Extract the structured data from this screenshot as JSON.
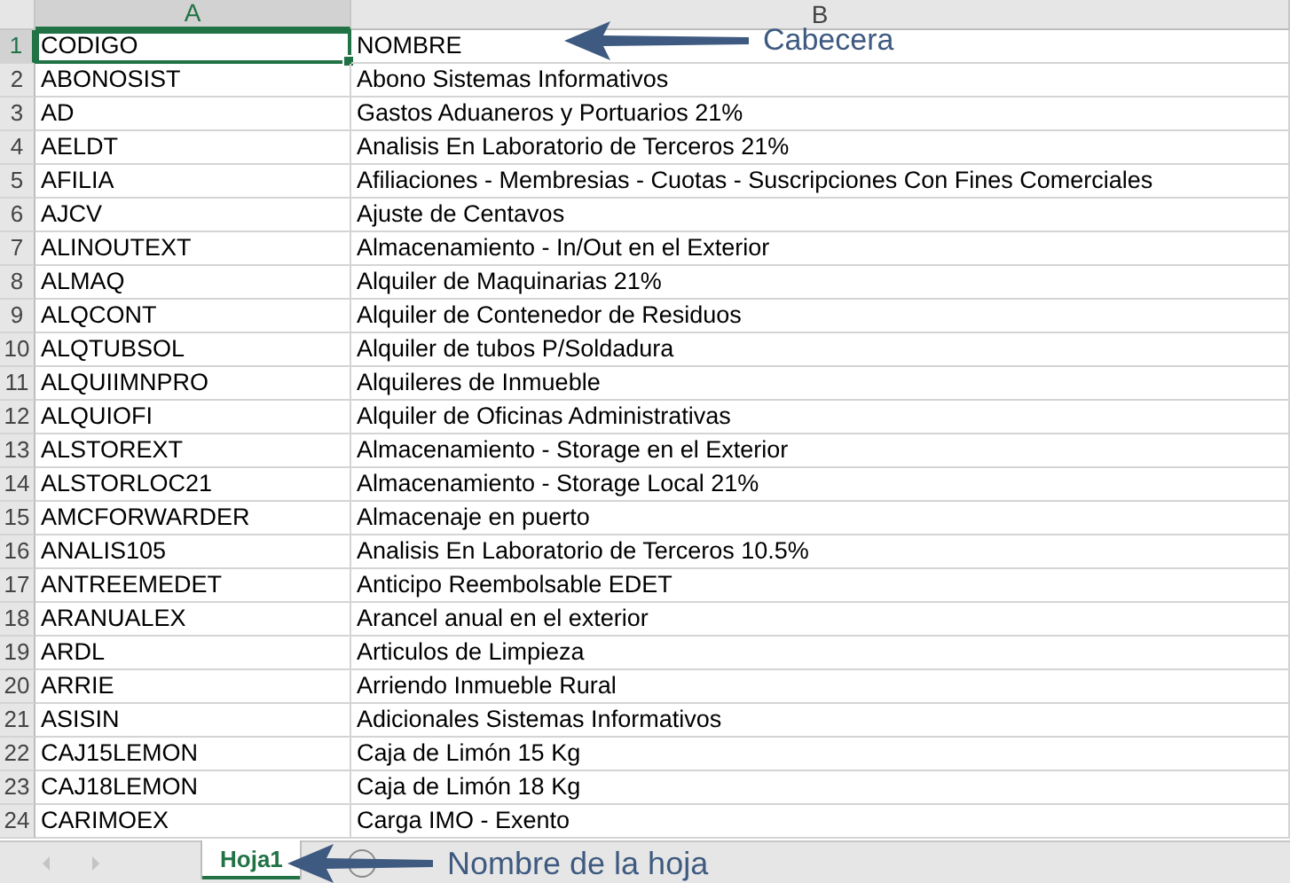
{
  "columns": [
    {
      "label": "A",
      "selected": true
    },
    {
      "label": "B",
      "selected": false
    }
  ],
  "rows": [
    {
      "number": "1",
      "code": "CODIGO",
      "name": "NOMBRE",
      "selected": true
    },
    {
      "number": "2",
      "code": "ABONOSIST",
      "name": "Abono Sistemas Informativos",
      "selected": false
    },
    {
      "number": "3",
      "code": "AD",
      "name": "Gastos Aduaneros y Portuarios 21%",
      "selected": false
    },
    {
      "number": "4",
      "code": "AELDT",
      "name": "Analisis En Laboratorio de Terceros 21%",
      "selected": false
    },
    {
      "number": "5",
      "code": "AFILIA",
      "name": "Afiliaciones - Membresias - Cuotas - Suscripciones Con Fines Comerciales",
      "selected": false
    },
    {
      "number": "6",
      "code": "AJCV",
      "name": "Ajuste de Centavos",
      "selected": false
    },
    {
      "number": "7",
      "code": "ALINOUTEXT",
      "name": "Almacenamiento - In/Out en el Exterior",
      "selected": false
    },
    {
      "number": "8",
      "code": "ALMAQ",
      "name": "Alquiler de Maquinarias 21%",
      "selected": false
    },
    {
      "number": "9",
      "code": "ALQCONT",
      "name": "Alquiler de Contenedor de Residuos",
      "selected": false
    },
    {
      "number": "10",
      "code": "ALQTUBSOL",
      "name": "Alquiler de tubos P/Soldadura",
      "selected": false
    },
    {
      "number": "11",
      "code": "ALQUIIMNPRO",
      "name": "Alquileres de Inmueble",
      "selected": false
    },
    {
      "number": "12",
      "code": "ALQUIOFI",
      "name": "Alquiler de Oficinas Administrativas",
      "selected": false
    },
    {
      "number": "13",
      "code": "ALSTOREXT",
      "name": "Almacenamiento - Storage en el Exterior",
      "selected": false
    },
    {
      "number": "14",
      "code": "ALSTORLOC21",
      "name": "Almacenamiento - Storage Local 21%",
      "selected": false
    },
    {
      "number": "15",
      "code": "AMCFORWARDER",
      "name": "Almacenaje en puerto",
      "selected": false
    },
    {
      "number": "16",
      "code": "ANALIS105",
      "name": "Analisis En Laboratorio de Terceros 10.5%",
      "selected": false
    },
    {
      "number": "17",
      "code": "ANTREEMEDET",
      "name": "Anticipo Reembolsable EDET",
      "selected": false
    },
    {
      "number": "18",
      "code": "ARANUALEX",
      "name": "Arancel anual en el exterior",
      "selected": false
    },
    {
      "number": "19",
      "code": "ARDL",
      "name": "Articulos de Limpieza",
      "selected": false
    },
    {
      "number": "20",
      "code": "ARRIE",
      "name": "Arriendo Inmueble Rural",
      "selected": false
    },
    {
      "number": "21",
      "code": "ASISIN",
      "name": "Adicionales Sistemas Informativos",
      "selected": false
    },
    {
      "number": "22",
      "code": "CAJ15LEMON",
      "name": "Caja de Limón 15 Kg",
      "selected": false
    },
    {
      "number": "23",
      "code": "CAJ18LEMON",
      "name": "Caja de Limón 18 Kg",
      "selected": false
    },
    {
      "number": "24",
      "code": "CARIMOEX",
      "name": "Carga IMO - Exento",
      "selected": false
    }
  ],
  "sheet_tabs": [
    {
      "label": "Hoja1",
      "selected": true
    }
  ],
  "annotations": {
    "header": "Cabecera",
    "sheet_tab": "Nombre de la hoja"
  }
}
